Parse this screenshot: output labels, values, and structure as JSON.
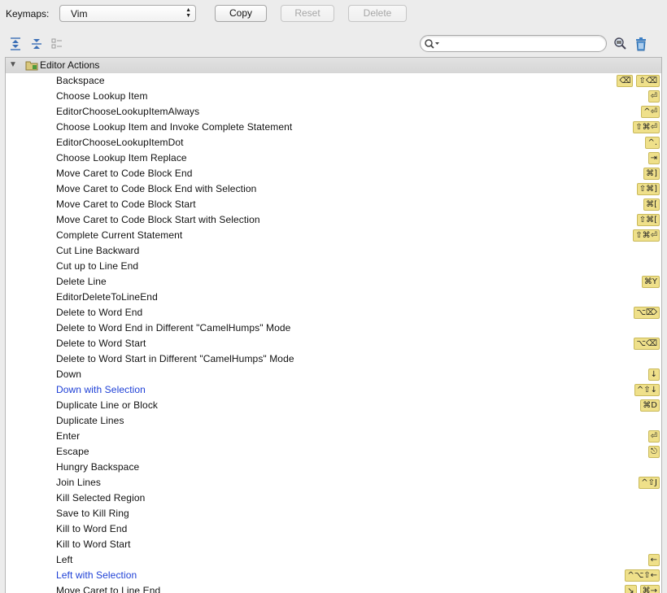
{
  "toolbar": {
    "keymaps_label": "Keymaps:",
    "keymap_selected": "Vim",
    "copy_label": "Copy",
    "reset_label": "Reset",
    "delete_label": "Delete"
  },
  "tools": {
    "expand_all_icon": "expand-all-icon",
    "collapse_all_icon": "collapse-all-icon",
    "edit_icon": "edit-shortcut-icon",
    "find_shortcut_icon": "find-by-shortcut-icon",
    "clear_icon": "trash-icon"
  },
  "search": {
    "value": "",
    "placeholder": ""
  },
  "colors": {
    "shortcut_bg": "#efe08a",
    "modified_text": "#1d3fd6",
    "group_bg": "#d6d6d6"
  },
  "tree": {
    "group_label": "Editor Actions",
    "actions": [
      {
        "name": "Backspace",
        "shortcuts": [
          "⌫",
          "⇧⌫"
        ],
        "modified": false
      },
      {
        "name": "Choose Lookup Item",
        "shortcuts": [
          "⏎"
        ],
        "modified": false
      },
      {
        "name": "EditorChooseLookupItemAlways",
        "shortcuts": [
          "^⏎"
        ],
        "modified": false
      },
      {
        "name": "Choose Lookup Item and Invoke Complete Statement",
        "shortcuts": [
          "⇧⌘⏎"
        ],
        "modified": false
      },
      {
        "name": "EditorChooseLookupItemDot",
        "shortcuts": [
          "^."
        ],
        "modified": false
      },
      {
        "name": "Choose Lookup Item Replace",
        "shortcuts": [
          "⇥"
        ],
        "modified": false
      },
      {
        "name": "Move Caret to Code Block End",
        "shortcuts": [
          "⌘]"
        ],
        "modified": false
      },
      {
        "name": "Move Caret to Code Block End with Selection",
        "shortcuts": [
          "⇧⌘]"
        ],
        "modified": false
      },
      {
        "name": "Move Caret to Code Block Start",
        "shortcuts": [
          "⌘["
        ],
        "modified": false
      },
      {
        "name": "Move Caret to Code Block Start with Selection",
        "shortcuts": [
          "⇧⌘["
        ],
        "modified": false
      },
      {
        "name": "Complete Current Statement",
        "shortcuts": [
          "⇧⌘⏎"
        ],
        "modified": false
      },
      {
        "name": "Cut Line Backward",
        "shortcuts": [],
        "modified": false
      },
      {
        "name": "Cut up to Line End",
        "shortcuts": [],
        "modified": false
      },
      {
        "name": "Delete Line",
        "shortcuts": [
          "⌘Y"
        ],
        "modified": false
      },
      {
        "name": "EditorDeleteToLineEnd",
        "shortcuts": [],
        "modified": false
      },
      {
        "name": "Delete to Word End",
        "shortcuts": [
          "⌥⌦"
        ],
        "modified": false
      },
      {
        "name": "Delete to Word End in Different \"CamelHumps\" Mode",
        "shortcuts": [],
        "modified": false
      },
      {
        "name": "Delete to Word Start",
        "shortcuts": [
          "⌥⌫"
        ],
        "modified": false
      },
      {
        "name": "Delete to Word Start in Different \"CamelHumps\" Mode",
        "shortcuts": [],
        "modified": false
      },
      {
        "name": "Down",
        "shortcuts": [
          "↓"
        ],
        "modified": false
      },
      {
        "name": "Down with Selection",
        "shortcuts": [
          "^⇧↓"
        ],
        "modified": true
      },
      {
        "name": "Duplicate Line or Block",
        "shortcuts": [
          "⌘D"
        ],
        "modified": false
      },
      {
        "name": "Duplicate Lines",
        "shortcuts": [],
        "modified": false
      },
      {
        "name": "Enter",
        "shortcuts": [
          "⏎"
        ],
        "modified": false
      },
      {
        "name": "Escape",
        "shortcuts": [
          "⎋"
        ],
        "modified": false
      },
      {
        "name": "Hungry Backspace",
        "shortcuts": [],
        "modified": false
      },
      {
        "name": "Join Lines",
        "shortcuts": [
          "^⇧J"
        ],
        "modified": false
      },
      {
        "name": "Kill Selected Region",
        "shortcuts": [],
        "modified": false
      },
      {
        "name": "Save to Kill Ring",
        "shortcuts": [],
        "modified": false
      },
      {
        "name": "Kill to Word End",
        "shortcuts": [],
        "modified": false
      },
      {
        "name": "Kill to Word Start",
        "shortcuts": [],
        "modified": false
      },
      {
        "name": "Left",
        "shortcuts": [
          "←"
        ],
        "modified": false
      },
      {
        "name": "Left with Selection",
        "shortcuts": [
          "^⌥⇧←"
        ],
        "modified": true
      },
      {
        "name": "Move Caret to Line End",
        "shortcuts": [
          "↘",
          "⌘→"
        ],
        "modified": false
      }
    ]
  }
}
